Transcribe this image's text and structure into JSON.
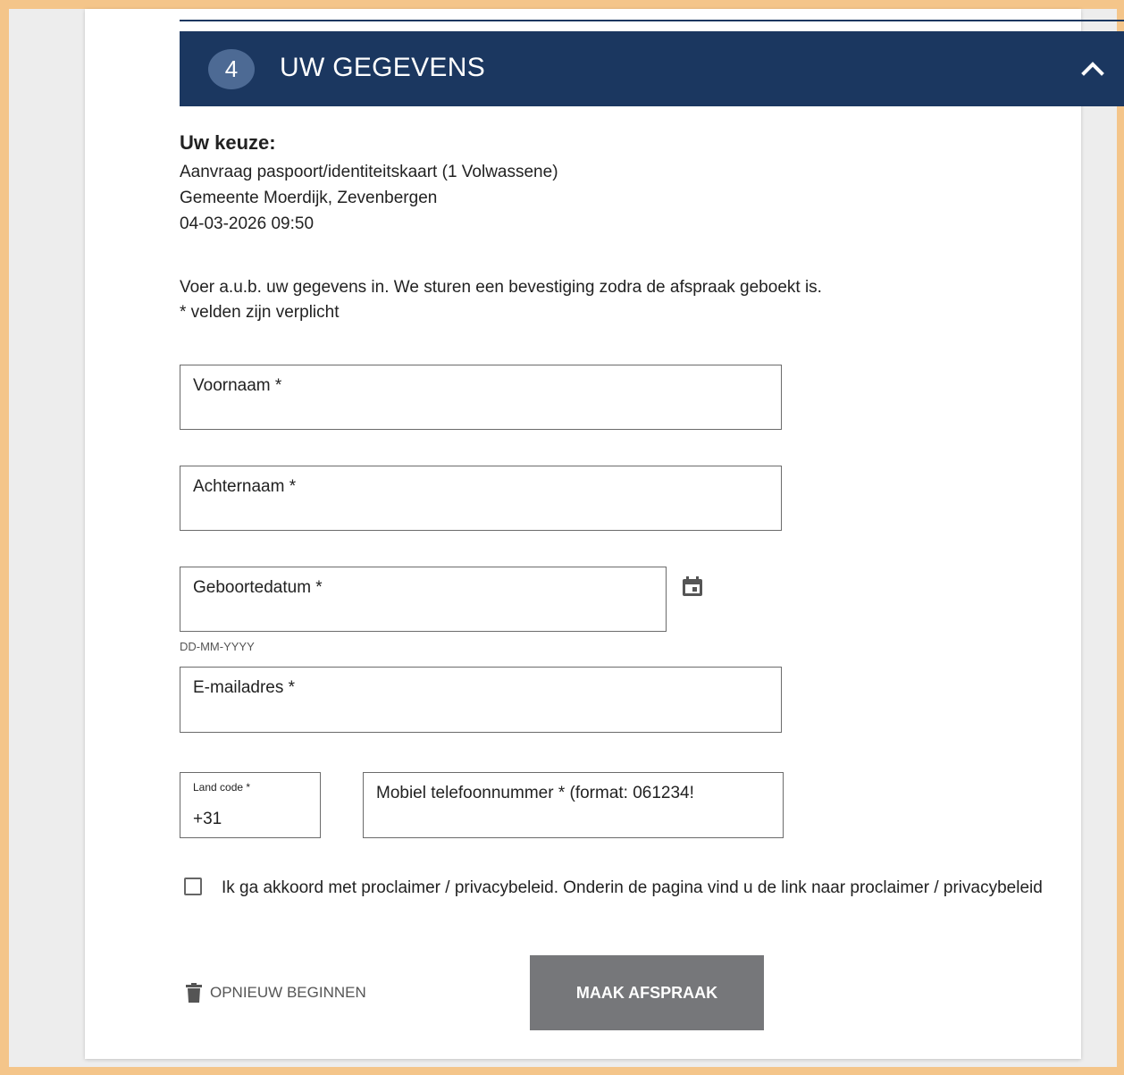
{
  "section": {
    "step_number": "4",
    "title": "UW GEGEVENS"
  },
  "choice": {
    "heading": "Uw keuze:",
    "service": "Aanvraag paspoort/identiteitskaart (1 Volwassene)",
    "location": "Gemeente Moerdijk, Zevenbergen",
    "datetime": "04-03-2026 09:50"
  },
  "intro": {
    "text": "Voer a.u.b. uw gegevens in. We sturen een bevestiging zodra de afspraak geboekt is.",
    "required_note": "* velden zijn verplicht"
  },
  "form": {
    "first_name_label": "Voornaam *",
    "last_name_label": "Achternaam *",
    "birthdate_label": "Geboortedatum *",
    "birthdate_hint": "DD-MM-YYYY",
    "email_label": "E-mailadres *",
    "country_code_label": "Land code *",
    "country_code_value": "+31",
    "phone_label": "Mobiel telefoonnummer * (format: 061234!"
  },
  "consent": {
    "label": "Ik ga akkoord met proclaimer / privacybeleid. Onderin de pagina vind u de link naar proclaimer / privacybeleid",
    "checked": false
  },
  "actions": {
    "restart_label": "OPNIEUW BEGINNEN",
    "submit_label": "MAAK AFSPRAAK"
  },
  "colors": {
    "header_bg": "#1b3760",
    "badge_bg": "#4d6a94",
    "submit_bg": "#76777a",
    "page_frame": "#f4c58a"
  },
  "icons": {
    "collapse": "chevron-up-icon",
    "date_picker": "calendar-icon",
    "restart": "trash-icon"
  }
}
